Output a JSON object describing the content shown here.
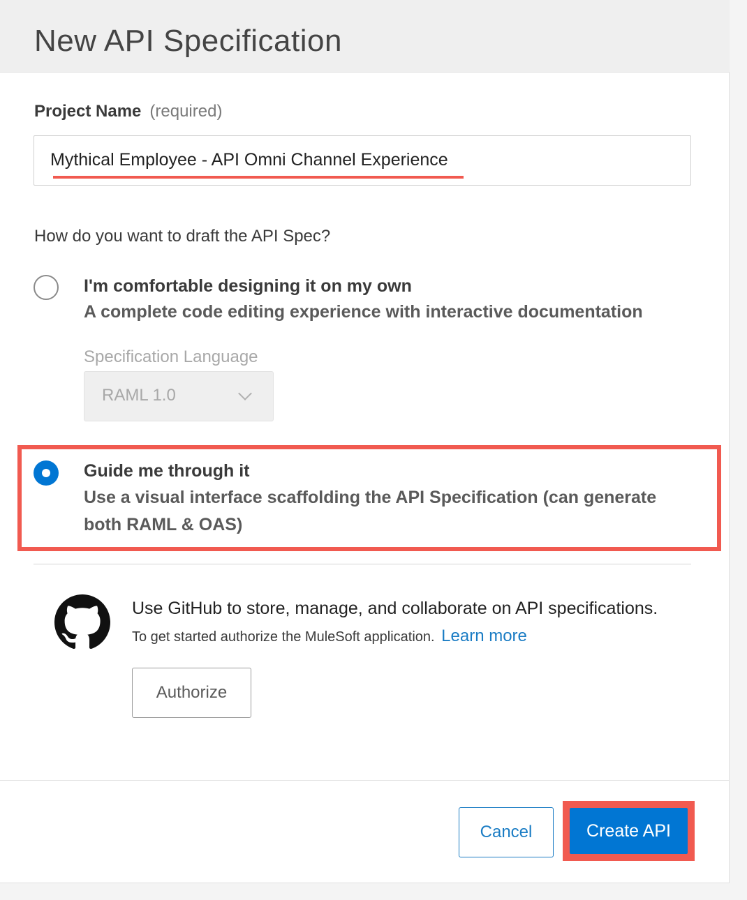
{
  "dialog": {
    "title": "New API Specification"
  },
  "project": {
    "label": "Project Name",
    "required_hint": "(required)",
    "value": "Mythical Employee - API Omni Channel Experience"
  },
  "question": "How do you want to draft the API Spec?",
  "options": [
    {
      "title": "I'm comfortable designing it on my own",
      "description": "A complete code editing experience with interactive documentation",
      "selected": false
    },
    {
      "title": "Guide me through it",
      "description": "Use a visual interface scaffolding the API Specification (can generate both RAML & OAS)",
      "selected": true
    }
  ],
  "spec_language": {
    "label": "Specification Language",
    "value": "RAML 1.0",
    "disabled": true
  },
  "github": {
    "title": "Use GitHub to store, manage, and collaborate on API specifications.",
    "subtitle": "To get started authorize the MuleSoft application.",
    "link": "Learn more",
    "authorize_label": "Authorize"
  },
  "footer": {
    "cancel_label": "Cancel",
    "create_label": "Create API"
  },
  "colors": {
    "accent": "#0176d3",
    "annotation": "#f15a50",
    "link": "#1a7cc4"
  }
}
